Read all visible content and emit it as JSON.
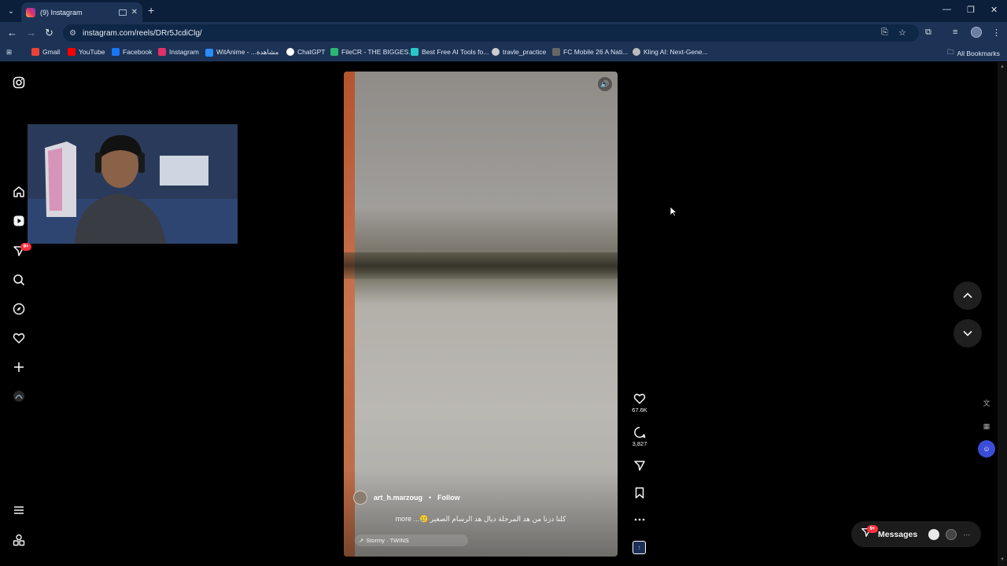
{
  "browser": {
    "tab_title": "(9) Instagram",
    "url": "instagram.com/reels/DRr5JcdiClg/",
    "bookmarks": [
      {
        "label": "Gmail",
        "color": "#ea4335"
      },
      {
        "label": "YouTube",
        "color": "#ff0000"
      },
      {
        "label": "Facebook",
        "color": "#1877f2"
      },
      {
        "label": "Instagram",
        "color": "#e1306c"
      },
      {
        "label": "WitAnime - ...مشاهدة",
        "color": "#2a8cff"
      },
      {
        "label": "ChatGPT",
        "color": "#ffffff"
      },
      {
        "label": "FileCR - THE BIGGES...",
        "color": "#2bb673"
      },
      {
        "label": "Best Free AI Tools fo...",
        "color": "#28c7c7"
      },
      {
        "label": "travle_practice",
        "color": "#cccccc"
      },
      {
        "label": "FC Mobile 26 A Nati...",
        "color": "#666666"
      },
      {
        "label": "Kling AI: Next-Gene...",
        "color": "#bbbbbb"
      }
    ],
    "all_bookmarks": "All Bookmarks"
  },
  "sidebar": {
    "notification_badge": "9+"
  },
  "reel": {
    "username": "art_h.marzoug",
    "follow_label": "Follow",
    "caption": "كلنا دزنا من هد المرحلة ديال هد الرسام الصغير 🥲... more",
    "audio": "Stormy · TWINS",
    "likes": "67.6K",
    "comments": "3,827"
  },
  "messages": {
    "label": "Messages",
    "badge": "9+"
  },
  "colors": {
    "chrome_tab_bg": "#0b1e3a",
    "chrome_toolbar_bg": "#1c3356",
    "badge_red": "#ff3040"
  }
}
